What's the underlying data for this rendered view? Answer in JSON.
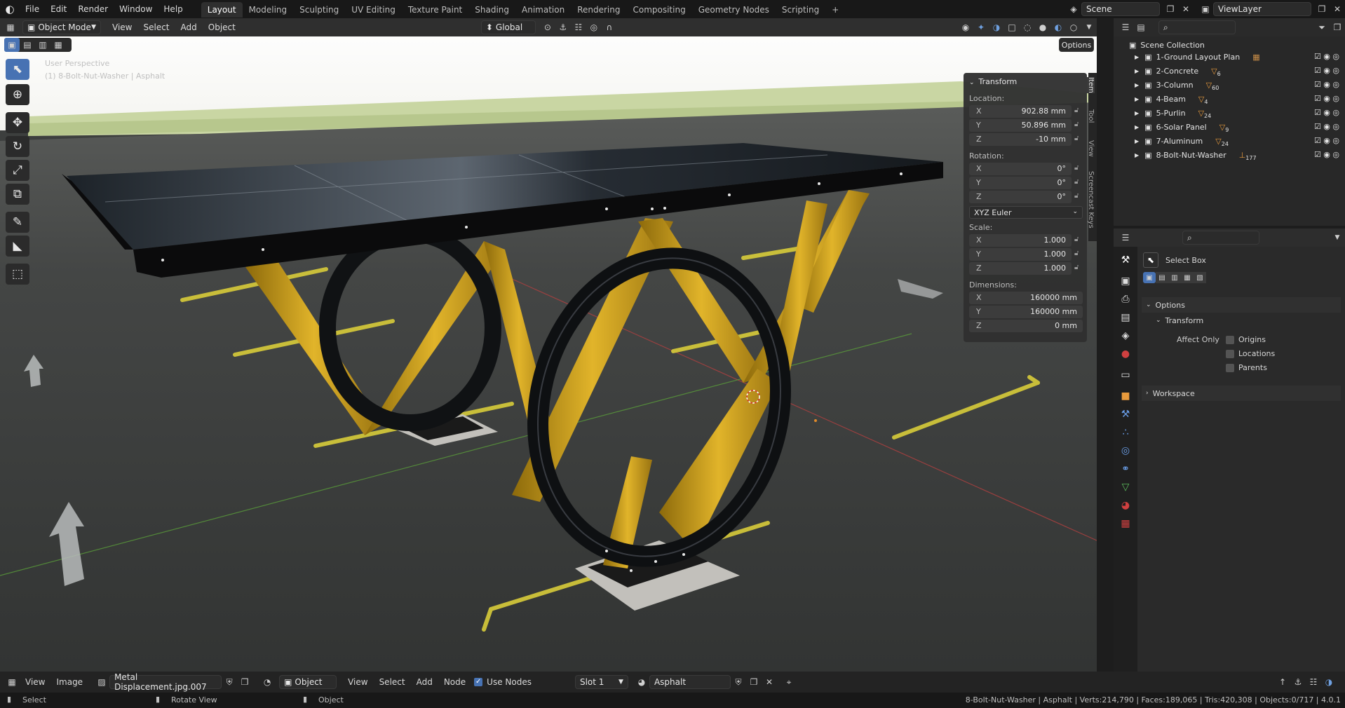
{
  "topbar": {
    "menus": [
      "File",
      "Edit",
      "Render",
      "Window",
      "Help"
    ],
    "workspaces": [
      "Layout",
      "Modeling",
      "Sculpting",
      "UV Editing",
      "Texture Paint",
      "Shading",
      "Animation",
      "Rendering",
      "Compositing",
      "Geometry Nodes",
      "Scripting"
    ],
    "active_workspace": "Layout",
    "add_tab": "+",
    "scene_name": "Scene",
    "view_layer": "ViewLayer"
  },
  "viewport_header": {
    "mode": "Object Mode",
    "menus": [
      "View",
      "Select",
      "Add",
      "Object"
    ],
    "transform_orientation": "Global",
    "options_label": "Options"
  },
  "viewport_overlay": {
    "perspective": "User Perspective",
    "object_info": "(1) 8-Bolt-Nut-Washer | Asphalt"
  },
  "n_panel": {
    "title": "Transform",
    "location_label": "Location:",
    "location": {
      "x": "902.88 mm",
      "y": "50.896 mm",
      "z": "-10 mm"
    },
    "rotation_label": "Rotation:",
    "rotation": {
      "x": "0°",
      "y": "0°",
      "z": "0°"
    },
    "rotation_mode": "XYZ Euler",
    "scale_label": "Scale:",
    "scale": {
      "x": "1.000",
      "y": "1.000",
      "z": "1.000"
    },
    "dimensions_label": "Dimensions:",
    "dimensions": {
      "x": "160000 mm",
      "y": "160000 mm",
      "z": "0 mm"
    },
    "axis_labels": {
      "x": "X",
      "y": "Y",
      "z": "Z"
    },
    "side_tabs": [
      "Item",
      "Tool",
      "View",
      "Screencast Keys"
    ]
  },
  "outliner": {
    "root": "Scene Collection",
    "collections": [
      {
        "name": "1-Ground Layout Plan",
        "badge": ""
      },
      {
        "name": "2-Concrete",
        "badge": "6"
      },
      {
        "name": "3-Column",
        "badge": "60"
      },
      {
        "name": "4-Beam",
        "badge": "4"
      },
      {
        "name": "5-Purlin",
        "badge": "24"
      },
      {
        "name": "6-Solar Panel",
        "badge": "9"
      },
      {
        "name": "7-Aluminum",
        "badge": "24"
      },
      {
        "name": "8-Bolt-Nut-Washer",
        "badge": "177"
      }
    ]
  },
  "properties": {
    "tool_name": "Select Box",
    "options_label": "Options",
    "transform_label": "Transform",
    "affect_only_label": "Affect Only",
    "affect_options": [
      "Origins",
      "Locations",
      "Parents"
    ],
    "workspace_label": "Workspace"
  },
  "bottom_editor": {
    "menus": [
      "View",
      "Image"
    ],
    "image_name": "Metal Displacement.jpg.007",
    "object_type": "Object",
    "node_menus": [
      "View",
      "Select",
      "Add",
      "Node"
    ],
    "use_nodes_label": "Use Nodes",
    "slot": "Slot 1",
    "material": "Asphalt"
  },
  "statusbar": {
    "select": "Select",
    "rotate": "Rotate View",
    "object": "Object",
    "stats": "8-Bolt-Nut-Washer | Asphalt | Verts:214,790 | Faces:189,065 | Tris:420,308 | Objects:0/717 | 4.0.1"
  },
  "colors": {
    "accent": "#4772b3",
    "gold": "#c79a12",
    "ground": "#3a3c3c",
    "line_yellow": "#d8cc3a"
  }
}
